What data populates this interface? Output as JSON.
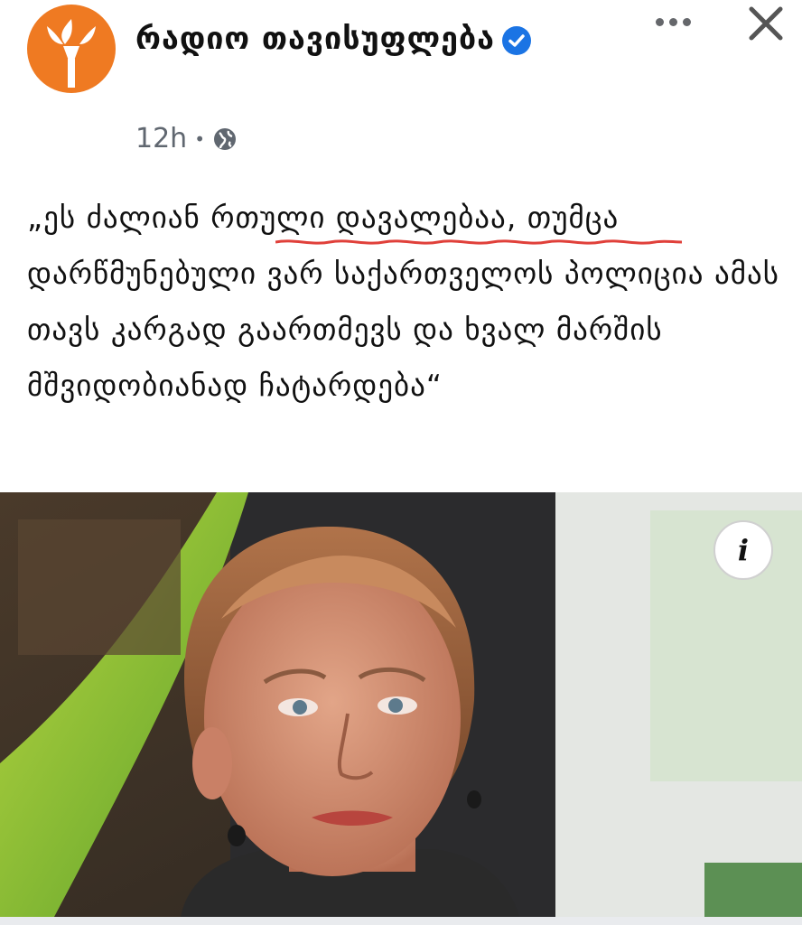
{
  "post": {
    "page_name": "რადიო თავისუფლება",
    "time": "12h",
    "separator": "•",
    "text": "„ეს ძალიან რთული დავალებაა, თუმცა დარწმუნებული ვარ საქართველოს პოლიცია ამას თავს კარგად გაართმევს და ხვალ მარშის მშვიდობიანად ჩატარდება“",
    "icons": {
      "avatar": "radio-liberty-torch-logo",
      "verified": "verified-badge-icon",
      "privacy": "globe-icon",
      "more": "more-options-icon",
      "close": "close-icon",
      "info": "info-icon"
    },
    "info_label": "i"
  },
  "colors": {
    "brand_orange": "#ef7a22",
    "verified_blue": "#1b74e4",
    "spellcheck_red": "#e0403a"
  }
}
